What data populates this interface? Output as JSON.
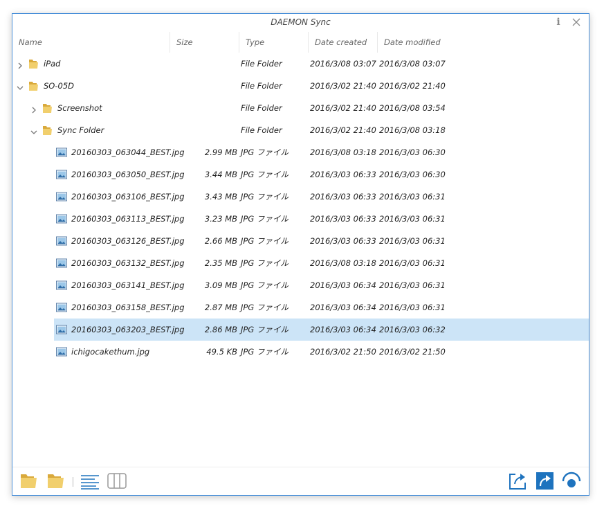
{
  "app": {
    "title": "DAEMON Sync"
  },
  "titlebar": {
    "info_label": "i"
  },
  "columns": {
    "name": "Name",
    "size": "Size",
    "type": "Type",
    "created": "Date created",
    "modified": "Date modified"
  },
  "rows": [
    {
      "name": "iPad",
      "size": "",
      "type": "File Folder",
      "created": "2016/3/08 03:07",
      "modified": "2016/3/08 03:07",
      "kind": "folder",
      "level": 0,
      "expander": "collapsed",
      "selected": false
    },
    {
      "name": "SO-05D",
      "size": "",
      "type": "File Folder",
      "created": "2016/3/02 21:40",
      "modified": "2016/3/02 21:40",
      "kind": "folder",
      "level": 0,
      "expander": "expanded",
      "selected": false
    },
    {
      "name": "Screenshot",
      "size": "",
      "type": "File Folder",
      "created": "2016/3/02 21:40",
      "modified": "2016/3/08 03:54",
      "kind": "folder",
      "level": 1,
      "expander": "collapsed",
      "selected": false
    },
    {
      "name": "Sync Folder",
      "size": "",
      "type": "File Folder",
      "created": "2016/3/02 21:40",
      "modified": "2016/3/08 03:18",
      "kind": "folder",
      "level": 1,
      "expander": "expanded",
      "selected": false
    },
    {
      "name": "20160303_063044_BEST.jpg",
      "size": "2.99 MB",
      "type": "JPG ファイル",
      "created": "2016/3/08 03:18",
      "modified": "2016/3/03 06:30",
      "kind": "image",
      "level": 2,
      "expander": "none",
      "selected": false
    },
    {
      "name": "20160303_063050_BEST.jpg",
      "size": "3.44 MB",
      "type": "JPG ファイル",
      "created": "2016/3/03 06:33",
      "modified": "2016/3/03 06:30",
      "kind": "image",
      "level": 2,
      "expander": "none",
      "selected": false
    },
    {
      "name": "20160303_063106_BEST.jpg",
      "size": "3.43 MB",
      "type": "JPG ファイル",
      "created": "2016/3/03 06:33",
      "modified": "2016/3/03 06:31",
      "kind": "image",
      "level": 2,
      "expander": "none",
      "selected": false
    },
    {
      "name": "20160303_063113_BEST.jpg",
      "size": "3.23 MB",
      "type": "JPG ファイル",
      "created": "2016/3/03 06:33",
      "modified": "2016/3/03 06:31",
      "kind": "image",
      "level": 2,
      "expander": "none",
      "selected": false
    },
    {
      "name": "20160303_063126_BEST.jpg",
      "size": "2.66 MB",
      "type": "JPG ファイル",
      "created": "2016/3/03 06:33",
      "modified": "2016/3/03 06:31",
      "kind": "image",
      "level": 2,
      "expander": "none",
      "selected": false
    },
    {
      "name": "20160303_063132_BEST.jpg",
      "size": "2.35 MB",
      "type": "JPG ファイル",
      "created": "2016/3/08 03:18",
      "modified": "2016/3/03 06:31",
      "kind": "image",
      "level": 2,
      "expander": "none",
      "selected": false
    },
    {
      "name": "20160303_063141_BEST.jpg",
      "size": "3.09 MB",
      "type": "JPG ファイル",
      "created": "2016/3/03 06:34",
      "modified": "2016/3/03 06:31",
      "kind": "image",
      "level": 2,
      "expander": "none",
      "selected": false
    },
    {
      "name": "20160303_063158_BEST.jpg",
      "size": "2.87 MB",
      "type": "JPG ファイル",
      "created": "2016/3/03 06:34",
      "modified": "2016/3/03 06:31",
      "kind": "image",
      "level": 2,
      "expander": "none",
      "selected": false
    },
    {
      "name": "20160303_063203_BEST.jpg",
      "size": "2.86 MB",
      "type": "JPG ファイル",
      "created": "2016/3/03 06:34",
      "modified": "2016/3/03 06:32",
      "kind": "image",
      "level": 2,
      "expander": "none",
      "selected": true
    },
    {
      "name": "ichigocakethum.jpg",
      "size": "49.5 KB",
      "type": "JPG ファイル",
      "created": "2016/3/02 21:50",
      "modified": "2016/3/02 21:50",
      "kind": "image",
      "level": 2,
      "expander": "none",
      "selected": false
    }
  ],
  "toolbar": {
    "left_icons": [
      "folder-icon",
      "folder-icon",
      "list-view-icon",
      "column-view-icon"
    ],
    "right_icons": [
      "share-icon",
      "forward-icon",
      "wifi-sync-icon"
    ]
  },
  "colors": {
    "accent": "#1e73be",
    "selection": "#cce4f7",
    "border": "#4a90d9",
    "folder": "#e8c25a"
  }
}
